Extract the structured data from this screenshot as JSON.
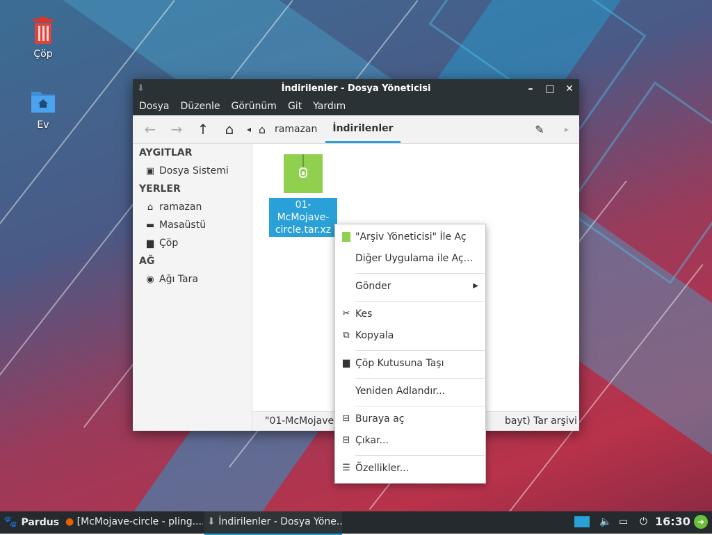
{
  "desktop": {
    "icons": [
      {
        "label": "Çöp",
        "icon": "trash-icon"
      },
      {
        "label": "Ev",
        "icon": "home-folder-icon"
      }
    ]
  },
  "window": {
    "title": "İndirilenler - Dosya Yöneticisi",
    "menu": [
      "Dosya",
      "Düzenle",
      "Görünüm",
      "Git",
      "Yardım"
    ],
    "breadcrumb": {
      "home": "ramazan",
      "current": "İndirilenler"
    },
    "sidebar": {
      "sections": [
        {
          "title": "AYGITLAR",
          "items": [
            {
              "label": "Dosya Sistemi",
              "icon": "drive-icon"
            }
          ]
        },
        {
          "title": "YERLER",
          "items": [
            {
              "label": "ramazan",
              "icon": "home-icon"
            },
            {
              "label": "Masaüstü",
              "icon": "desktop-icon"
            },
            {
              "label": "Çöp",
              "icon": "trash-icon"
            }
          ]
        },
        {
          "title": "AĞ",
          "items": [
            {
              "label": "Ağı Tara",
              "icon": "globe-icon"
            }
          ]
        }
      ]
    },
    "file": {
      "name_line1": "01-McMojave-",
      "name_line2": "circle.tar.xz"
    },
    "status": {
      "left": "\"01-McMojave-",
      "right": "bayt) Tar arşivi (..."
    }
  },
  "context_menu": {
    "items": [
      {
        "label": "\"Arşiv Yöneticisi\" İle Aç",
        "icon": "archive-icon"
      },
      {
        "label": "Diğer Uygulama ile Aç...",
        "icon": ""
      },
      {
        "label": "Gönder",
        "icon": "",
        "submenu": true
      },
      {
        "label": "Kes",
        "icon": "scissors-icon"
      },
      {
        "label": "Kopyala",
        "icon": "copy-icon"
      },
      {
        "label": "Çöp Kutusuna Taşı",
        "icon": "trash-icon"
      },
      {
        "label": "Yeniden Adlandır...",
        "icon": ""
      },
      {
        "label": "Buraya aç",
        "icon": "extract-icon"
      },
      {
        "label": "Çıkar...",
        "icon": "extract-icon"
      },
      {
        "label": "Özellikler...",
        "icon": "properties-icon"
      }
    ]
  },
  "taskbar": {
    "start": "Pardus",
    "tasks": [
      "[McMojave-circle - pling....",
      "İndirilenler - Dosya Yöne..."
    ],
    "clock": "16:30"
  }
}
